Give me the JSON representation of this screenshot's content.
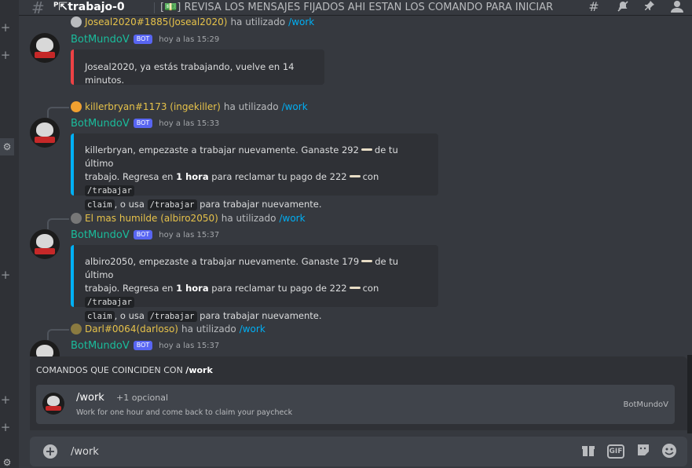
{
  "header": {
    "channel_name": "ᴾ⇱trabajo-0",
    "topic": "[💵] REVISA LOS MENSAJES FIJADOS AHI ESTAN LOS COMANDO PARA INICIAR",
    "icons": [
      "threads-icon",
      "mute-bell-icon",
      "pin-icon",
      "members-icon"
    ]
  },
  "messages": [
    {
      "reply_user": "Joseal2020#1885(Joseal2020)",
      "reply_text": "ha utilizado",
      "reply_cmd": "/work",
      "author": "BotMundoV",
      "badge": "BOT",
      "timestamp": "hoy a las 15:29",
      "embed_color": "#ed4245",
      "embed_text": "Joseal2020, ya estás trabajando, vuelve en 14 minutos."
    },
    {
      "reply_user": "killerbryan#1173 (ingekiller)",
      "reply_text": "ha utilizado",
      "reply_cmd": "/work",
      "author": "BotMundoV",
      "badge": "BOT",
      "timestamp": "hoy a las 15:33",
      "embed_color": "#00b0f4",
      "line1_a": "killerbryan, empezaste a trabajar nuevamente. Ganaste 292",
      "line1_b": "de tu último",
      "line2_a": "trabajo. Regresa en",
      "line2_bold": "1 hora",
      "line2_b": "para reclamar tu pago de 222",
      "line2_c": "con",
      "code1": "/trabajar",
      "code1b": "claim",
      "line3_a": ", o usa",
      "code2": "/trabajar",
      "line3_b": "para trabajar nuevamente."
    },
    {
      "reply_user": "El mas humilde (albiro2050)",
      "reply_text": "ha utilizado",
      "reply_cmd": "/work",
      "author": "BotMundoV",
      "badge": "BOT",
      "timestamp": "hoy a las 15:37",
      "embed_color": "#00b0f4",
      "line1_a": "albiro2050, empezaste a trabajar nuevamente. Ganaste 179",
      "line1_b": "de tu último",
      "line2_a": "trabajo. Regresa en",
      "line2_bold": "1 hora",
      "line2_b": "para reclamar tu pago de 222",
      "line2_c": "con",
      "code1": "/trabajar",
      "code1b": "claim",
      "line3_a": ", o usa",
      "code2": "/trabajar",
      "line3_b": "para trabajar nuevamente."
    },
    {
      "reply_user": "Darl#0064(darloso)",
      "reply_text": "ha utilizado",
      "reply_cmd": "/work",
      "author": "BotMundoV",
      "badge": "BOT",
      "timestamp": "hoy a las 15:37"
    }
  ],
  "autocomplete": {
    "title_prefix": "COMANDOS QUE COINCIDEN CON",
    "title_query": "/work",
    "command_name": "/work",
    "optional": "+1 opcional",
    "description": "Work for one hour and come back to claim your paycheck",
    "bot_name": "BotMundoV"
  },
  "composer": {
    "value": "/work",
    "icons": [
      "gift-icon",
      "gif-icon",
      "sticker-icon",
      "emoji-icon"
    ],
    "gif_label": "GIF"
  },
  "colors": {
    "bot_name": "#1abc9c",
    "reply_user": "#e6c24a",
    "command_link": "#00aff4",
    "bot_badge": "#5865f2"
  }
}
